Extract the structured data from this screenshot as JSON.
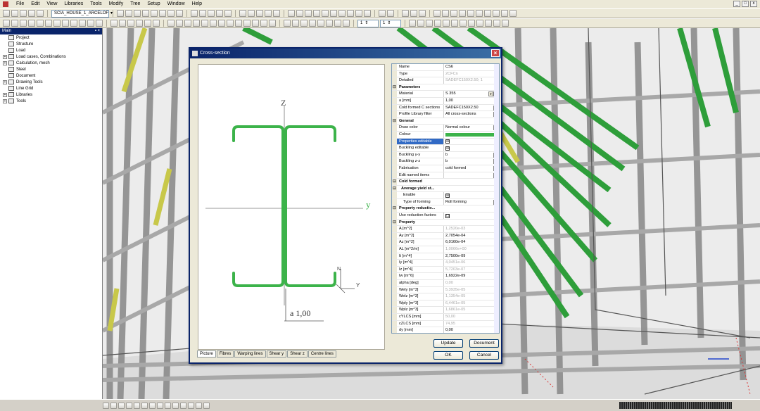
{
  "menu": [
    "File",
    "Edit",
    "View",
    "Libraries",
    "Tools",
    "Modify",
    "Tree",
    "Setup",
    "Window",
    "Help"
  ],
  "toolbar": {
    "project_combo": "SCIA_HOUSE_1_ARCELOF",
    "spin1": "1",
    "spin2": "1"
  },
  "tree": {
    "title": "Main",
    "items": [
      {
        "label": "Project",
        "expand": false
      },
      {
        "label": "Structure",
        "expand": false
      },
      {
        "label": "Load",
        "expand": false
      },
      {
        "label": "Load cases, Combinations",
        "expand": true
      },
      {
        "label": "Calculation, mesh",
        "expand": true
      },
      {
        "label": "Steel",
        "expand": false
      },
      {
        "label": "Document",
        "expand": false
      },
      {
        "label": "Drawing Tools",
        "expand": true
      },
      {
        "label": "Line Grid",
        "expand": false
      },
      {
        "label": "Libraries",
        "expand": true
      },
      {
        "label": "Tools",
        "expand": true
      }
    ]
  },
  "dialog": {
    "title": "Cross-section",
    "picture": {
      "axis_z": "Z",
      "axis_y": "y",
      "local_n": "N",
      "local_y": "Y",
      "dim_label": "a 1,00",
      "section_color": "#3cb34a"
    },
    "tabs": [
      "Picture",
      "Fibres",
      "Warping lines",
      "Shear y",
      "Shear z",
      "Centre lines"
    ],
    "properties": [
      {
        "t": "row",
        "label": "Name",
        "value": "CS6"
      },
      {
        "t": "row",
        "label": "Type",
        "value": "2CFCn",
        "ro": true
      },
      {
        "t": "row",
        "label": "Detailed",
        "value": "SADEFC150X2.50; 1",
        "ro": true
      },
      {
        "t": "sec",
        "label": "Parameters"
      },
      {
        "t": "row",
        "label": "Material",
        "value": "S 355",
        "dd": true,
        "ell": true
      },
      {
        "t": "row",
        "label": "a [mm]",
        "value": "1,00"
      },
      {
        "t": "row",
        "label": "Cold formed C sections",
        "value": "SADEFC150X2.50",
        "ell": true
      },
      {
        "t": "row",
        "label": "Profile Library filter",
        "value": "All cross-sections",
        "dd": true
      },
      {
        "t": "sec",
        "label": "General"
      },
      {
        "t": "row",
        "label": "Draw color",
        "value": "Normal colour",
        "dd": true
      },
      {
        "t": "row",
        "label": "Colour",
        "value": "",
        "swatch": true
      },
      {
        "t": "row",
        "label": "Properties editable",
        "value": "☒",
        "chk": true,
        "hl": true
      },
      {
        "t": "row",
        "label": "Buckling editable",
        "value": "☒",
        "chk": true
      },
      {
        "t": "row",
        "label": "Buckling y-y",
        "value": "b",
        "dd": true
      },
      {
        "t": "row",
        "label": "Buckling z-z",
        "value": "b",
        "dd": true
      },
      {
        "t": "row",
        "label": "Fabrication",
        "value": "cold formed",
        "dd": true
      },
      {
        "t": "row",
        "label": "Edit named items",
        "value": "",
        "ell": true
      },
      {
        "t": "sec",
        "label": "Cold formed"
      },
      {
        "t": "sub",
        "label": "Average yield st..."
      },
      {
        "t": "row",
        "label": "Enable",
        "value": "☒",
        "chk": true,
        "ind": true
      },
      {
        "t": "row",
        "label": "Type of forming",
        "value": "Roll forming",
        "dd": true,
        "ind": true
      },
      {
        "t": "sec",
        "label": "Property reductio..."
      },
      {
        "t": "row",
        "label": "Use reduction factors",
        "value": "☐",
        "chk": true
      },
      {
        "t": "sec",
        "label": "Property"
      },
      {
        "t": "row",
        "label": "A [m^2]",
        "value": "1,2520e-03",
        "ro": true
      },
      {
        "t": "row",
        "label": "Ay [m^2]",
        "value": "2,7054e-04"
      },
      {
        "t": "row",
        "label": "Az [m^2]",
        "value": "6,0160e-04"
      },
      {
        "t": "row",
        "label": "AL [m^2/m]",
        "value": "1,0066e+00",
        "ro": true
      },
      {
        "t": "row",
        "label": "It [m^4]",
        "value": "2,7500e-09"
      },
      {
        "t": "row",
        "label": "Iy [m^4]",
        "value": "4,0451e-06",
        "ro": true
      },
      {
        "t": "row",
        "label": "Iz [m^4]",
        "value": "5,7203e-07",
        "ro": true
      },
      {
        "t": "row",
        "label": "Iw [m^6]",
        "value": "1,6922e-09"
      },
      {
        "t": "row",
        "label": "alpha [deg]",
        "value": "0,00",
        "ro": true
      },
      {
        "t": "row",
        "label": "Wely [m^3]",
        "value": "5,3935e-05",
        "ro": true
      },
      {
        "t": "row",
        "label": "Welz [m^3]",
        "value": "1,1354e-05",
        "ro": true
      },
      {
        "t": "row",
        "label": "Wply [m^3]",
        "value": "6,4461e-05",
        "ro": true
      },
      {
        "t": "row",
        "label": "Wplz [m^3]",
        "value": "1,6861e-05",
        "ro": true
      },
      {
        "t": "row",
        "label": "cYLCS [mm]",
        "value": "50,00",
        "ro": true
      },
      {
        "t": "row",
        "label": "cZLCS [mm]",
        "value": "74,95",
        "ro": true
      },
      {
        "t": "row",
        "label": "dy [mm]",
        "value": "0,00"
      }
    ],
    "buttons": {
      "update": "Update",
      "document": "Document",
      "ok": "OK",
      "cancel": "Cancel"
    }
  },
  "colors": {
    "steel_green": "#2e9e3a",
    "steel_yellow": "#c8c84a",
    "steel_grey": "#c8c8c8"
  }
}
